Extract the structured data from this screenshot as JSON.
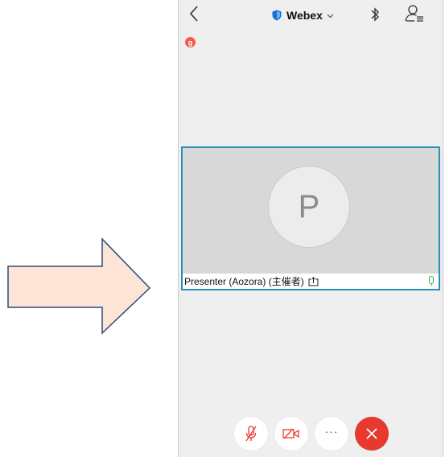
{
  "header": {
    "title": "Webex",
    "icons": [
      "back-chevron-icon",
      "shield-icon",
      "chevron-down-icon",
      "bluetooth-icon",
      "participants-icon"
    ]
  },
  "recording_badge": {
    "label": "g"
  },
  "tile": {
    "avatar_initial": "P",
    "participant_name": "Presenter (Aozora) (主催者)",
    "icons": [
      "share-icon",
      "mic-level-icon"
    ]
  },
  "controls": {
    "more_label": "···",
    "icons": [
      "mic-off-icon",
      "video-off-icon",
      "more-icon",
      "leave-icon"
    ]
  },
  "colors": {
    "accent": "#2a8fbd",
    "leave_red": "#e8392e",
    "arrow_fill": "#fce4d6",
    "arrow_stroke": "#2f4a7a",
    "mic_green": "#2bb24c"
  }
}
